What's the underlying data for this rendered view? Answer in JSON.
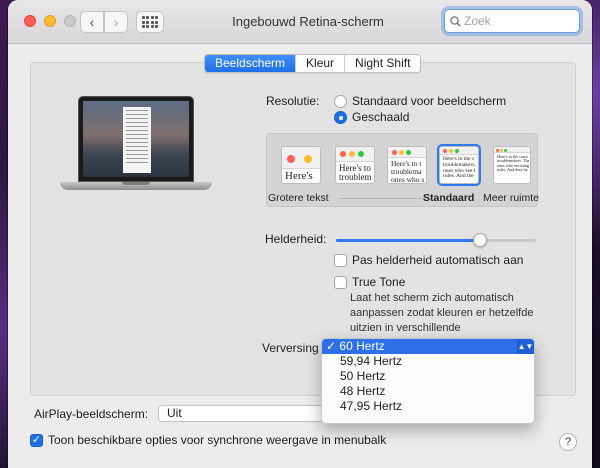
{
  "window": {
    "title": "Ingebouwd Retina-scherm",
    "search_placeholder": "Zoek",
    "nav_back": "‹",
    "nav_forward": "›"
  },
  "tabs": [
    {
      "label": "Beeldscherm",
      "active": true
    },
    {
      "label": "Kleur",
      "active": false
    },
    {
      "label": "Night Shift",
      "active": false
    }
  ],
  "resolution": {
    "label": "Resolutie:",
    "options": [
      {
        "label": "Standaard voor beeldscherm",
        "selected": false
      },
      {
        "label": "Geschaald",
        "selected": true
      }
    ]
  },
  "scaling": {
    "thumb_texts": [
      "Here's",
      "Here's to\ntroublem",
      "Here's to t\ntroublema\nones who s",
      "Here's to the c\ntroublemakers.\nones who see t\nrules. And the",
      "Here's to the crazy\ntroublemakers. The\nones who see thing\nrules. And they ha"
    ],
    "selected_index": 3,
    "caption_left": "Grotere tekst",
    "caption_default": "Standaard",
    "caption_right": "Meer ruimte"
  },
  "brightness": {
    "label": "Helderheid:",
    "value": 0.72,
    "auto_label": "Pas helderheid automatisch aan",
    "auto_checked": false
  },
  "true_tone": {
    "label": "True Tone",
    "checked": false,
    "note": "Laat het scherm zich automatisch aanpassen zodat kleuren er hetzelfde uitzien in verschillende omgevingslichtcondities."
  },
  "refresh": {
    "label": "Verversing",
    "check_mark": "✓",
    "options": [
      "60 Hertz",
      "59,94 Hertz",
      "50 Hertz",
      "48 Hertz",
      "47,95 Hertz"
    ],
    "selected": "60 Hertz"
  },
  "airplay": {
    "label": "AirPlay-beeldscherm:",
    "value": "Uit"
  },
  "menubar_option": {
    "label": "Toon beschikbare opties voor synchrone weergave in menubalk",
    "checked": true
  },
  "help_label": "?",
  "colors": {
    "accent": "#1f6fe9",
    "close": "#fe5f57",
    "minimize": "#febc2e"
  }
}
